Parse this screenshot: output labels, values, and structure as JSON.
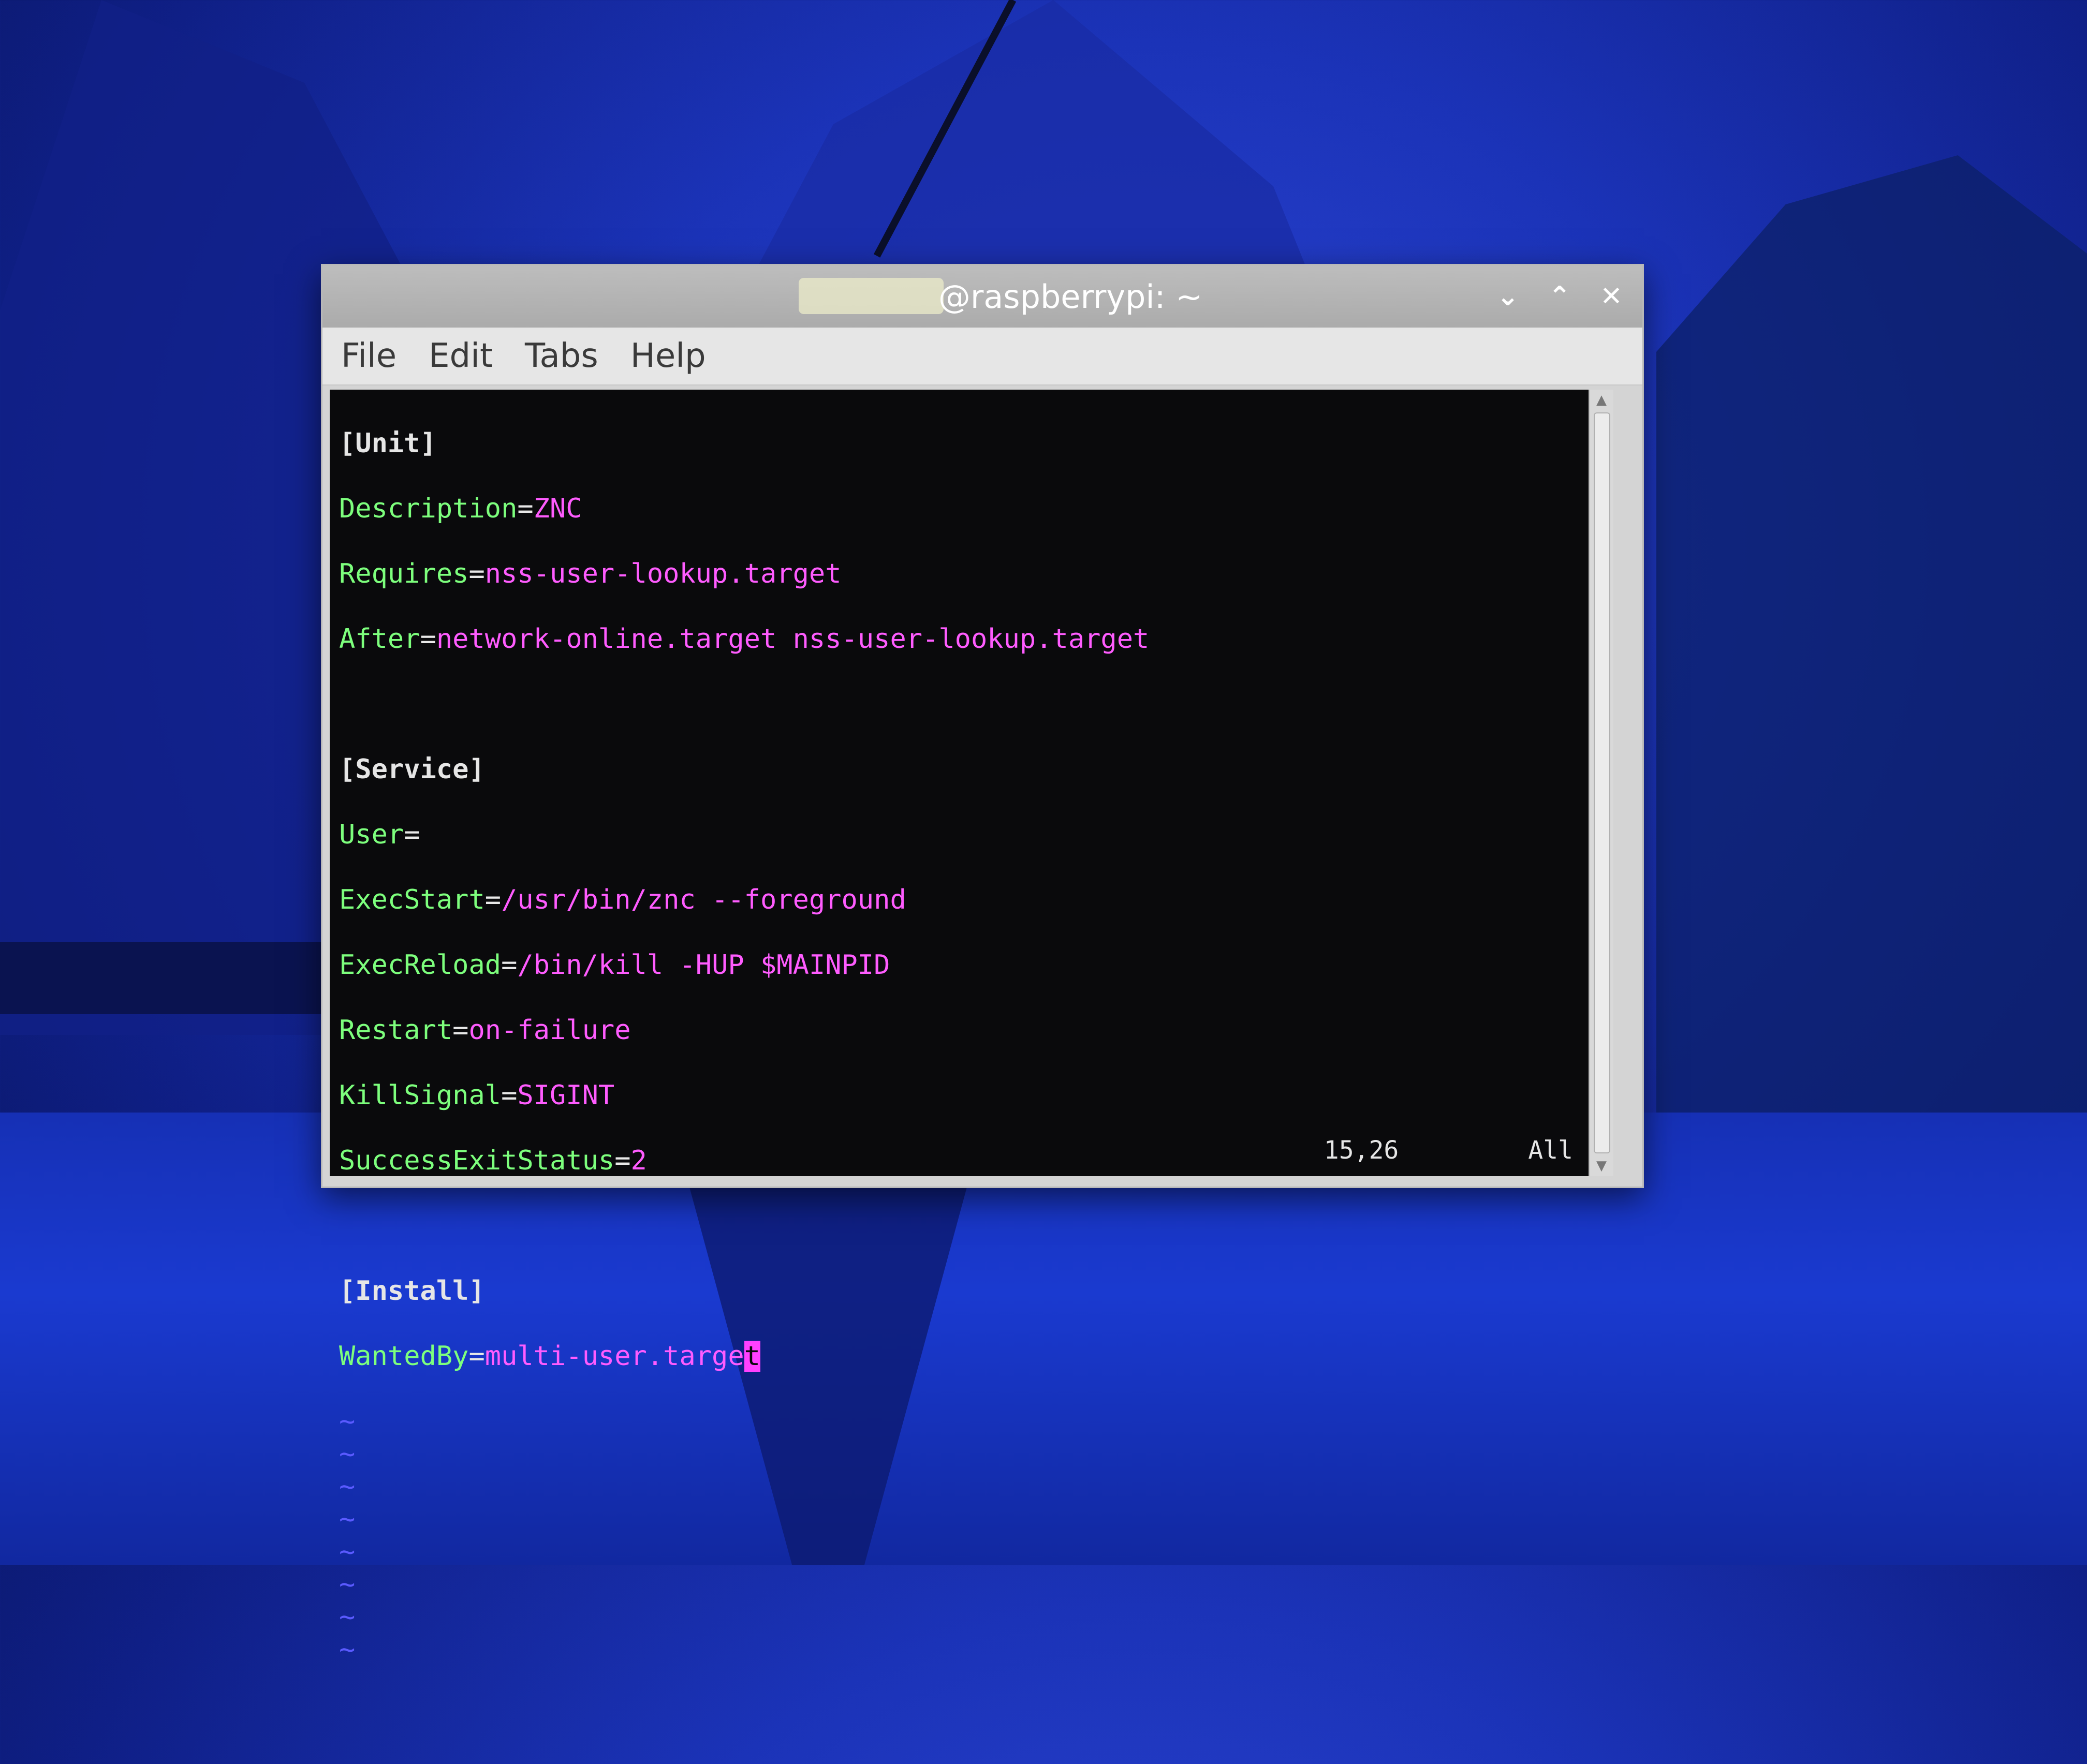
{
  "window": {
    "title": "@raspberrypi: ~",
    "controls": {
      "minimize": "⌄",
      "maximize": "⌃",
      "close": "✕"
    }
  },
  "menu": [
    "File",
    "Edit",
    "Tabs",
    "Help"
  ],
  "editor": {
    "unit_header": "[Unit]",
    "description_key": "Description",
    "description_value": "ZNC",
    "requires_key": "Requires",
    "requires_value": "nss-user-lookup.target",
    "after_key": "After",
    "after_value": "network-online.target nss-user-lookup.target",
    "service_header": "[Service]",
    "user_key": "User",
    "user_value": "",
    "execstart_key": "ExecStart",
    "execstart_value": "/usr/bin/znc --foreground",
    "execreload_key": "ExecReload",
    "execreload_value": "/bin/kill -HUP $MAINPID",
    "restart_key": "Restart",
    "restart_value": "on-failure",
    "killsignal_key": "KillSignal",
    "killsignal_value": "SIGINT",
    "successexit_key": "SuccessExitStatus",
    "successexit_value": "2",
    "install_header": "[Install]",
    "wantedby_key": "WantedBy",
    "wantedby_value_before_cursor": "multi-user.targe",
    "cursor_char": "t",
    "empty_line_marker": "~",
    "empty_lines": 8
  },
  "status": {
    "position": "15,26",
    "scroll": "All"
  },
  "colors": {
    "key": "#7dff7d",
    "value": "#ff5cff",
    "cursor": "#ff40ff",
    "tilde": "#5a5aff",
    "terminal_bg": "#0a0a0c"
  }
}
